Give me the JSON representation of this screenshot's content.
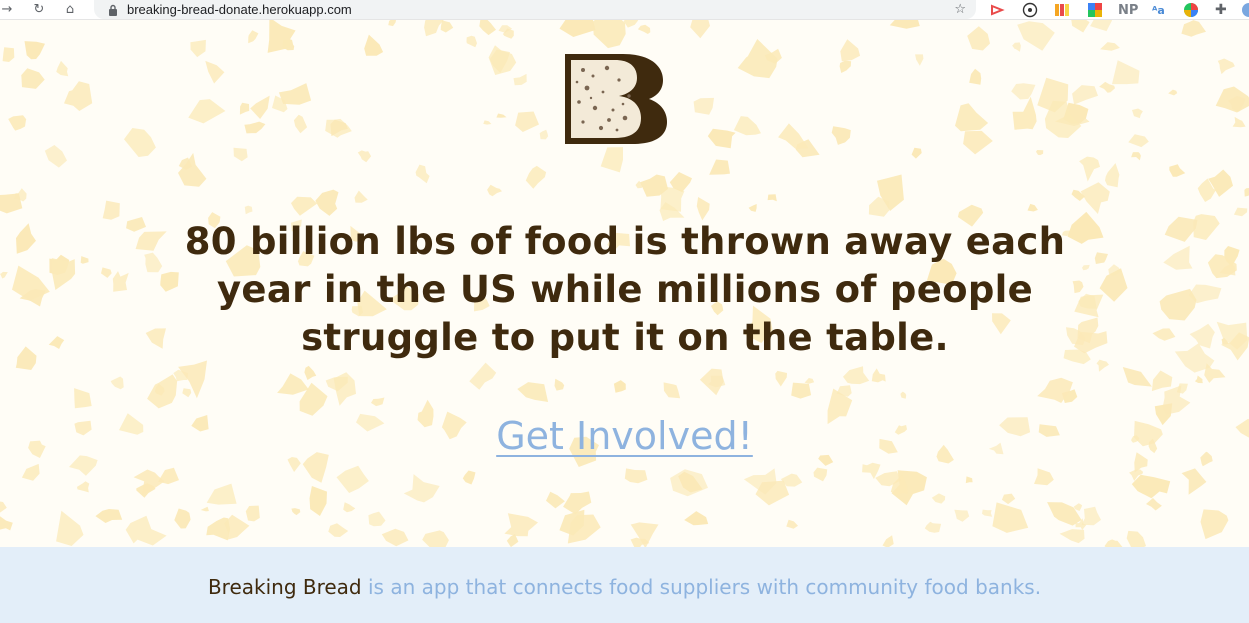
{
  "browser": {
    "url": "breaking-bread-donate.herokuapp.com",
    "extensions": [
      "play-icon",
      "circle-icon",
      "flag-icon",
      "puzzle-tile-icon",
      "NP",
      "text-icon",
      "color-wheel-icon",
      "extensions-icon",
      "profile-icon"
    ]
  },
  "hero": {
    "logo_letter": "B",
    "headline": "80 billion lbs of food is thrown away each year in the US while millions of people struggle to put it on the table.",
    "cta_label": "Get Involved!"
  },
  "about": {
    "brand": "Breaking Bread",
    "description": " is an app that connects food suppliers with community food banks."
  },
  "colors": {
    "brown": "#3f2a0e",
    "cta_blue": "#8eb3df",
    "pattern_yellow": "#fbe9b7",
    "band_blue": "#e3eef9"
  }
}
